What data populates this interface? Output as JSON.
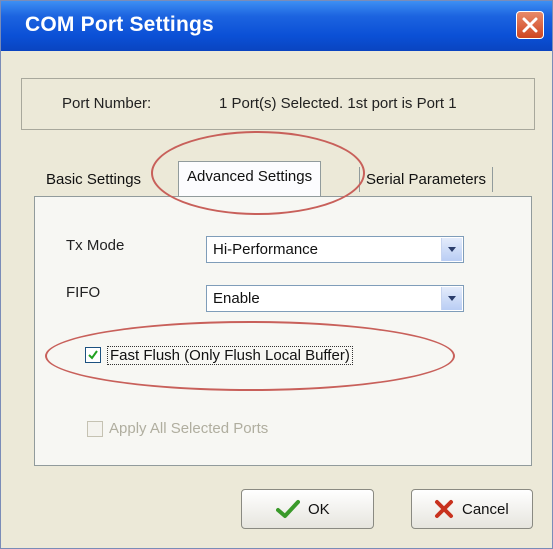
{
  "window": {
    "title": "COM Port Settings"
  },
  "port": {
    "label": "Port Number:",
    "value": "1 Port(s) Selected. 1st port is Port 1"
  },
  "tabs": [
    {
      "label": "Basic Settings"
    },
    {
      "label": "Advanced Settings"
    },
    {
      "label": "Serial Parameters"
    }
  ],
  "advanced": {
    "tx_mode": {
      "label": "Tx Mode",
      "value": "Hi-Performance"
    },
    "fifo": {
      "label": "FIFO",
      "value": "Enable"
    },
    "fast_flush": {
      "label": "Fast Flush (Only Flush Local Buffer)",
      "checked": true
    },
    "apply_all": {
      "label": "Apply All Selected Ports",
      "checked": false,
      "disabled": true
    }
  },
  "buttons": {
    "ok": "OK",
    "cancel": "Cancel"
  },
  "colors": {
    "title_bar": "#0b50d6",
    "annotation_circle": "#c8605a",
    "ok_check": "#3a9a2a",
    "cancel_x": "#c8321e"
  },
  "icons": {
    "close": "close-icon",
    "ok": "checkmark-icon",
    "cancel": "x-icon",
    "dropdown": "chevron-down-icon"
  }
}
